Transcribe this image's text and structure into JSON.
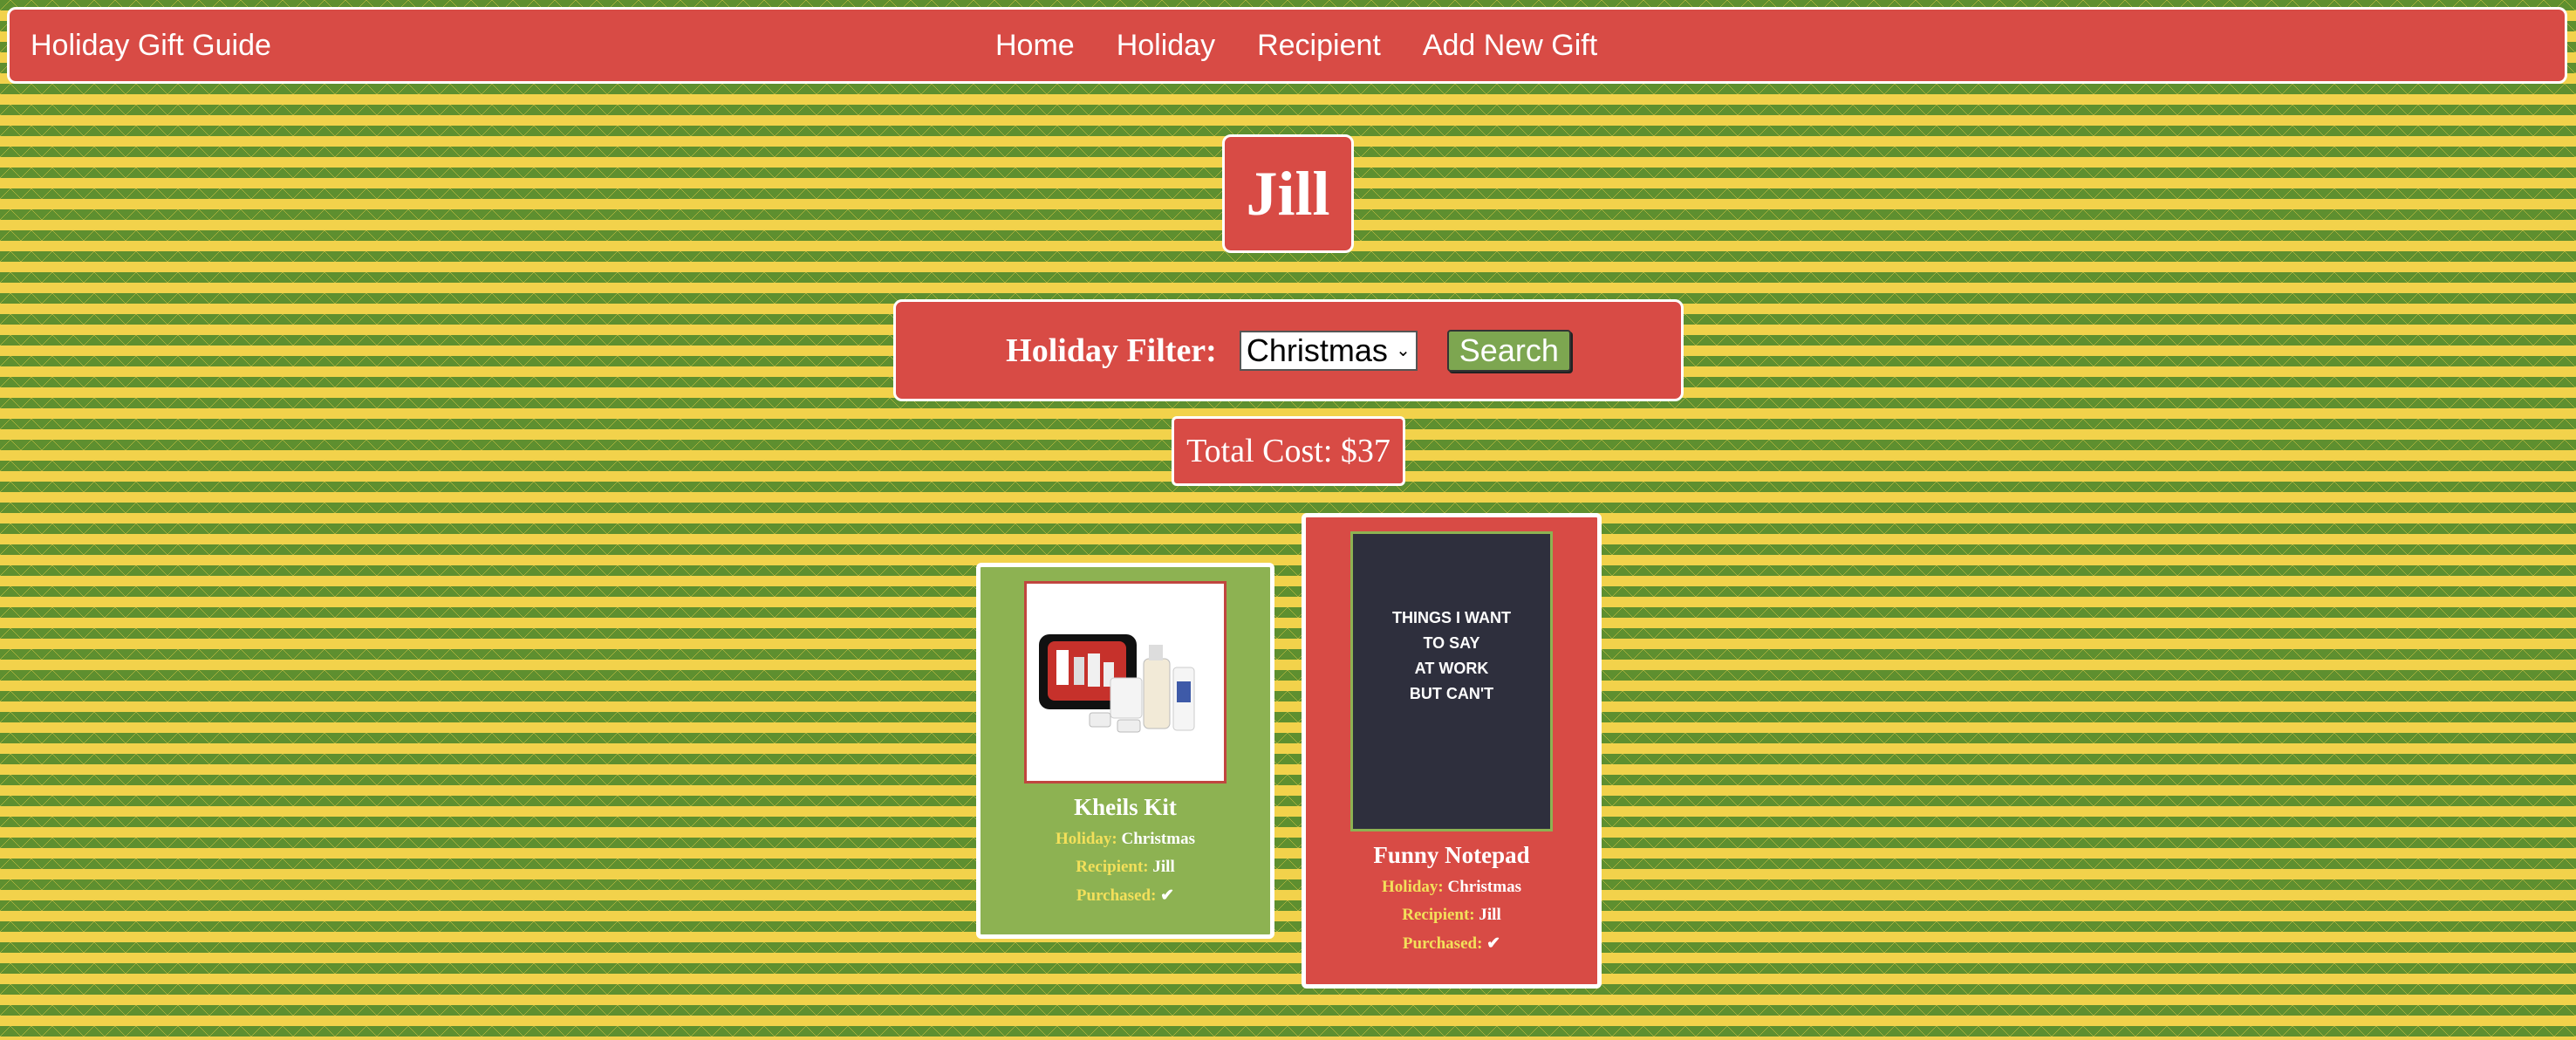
{
  "nav": {
    "brand": "Holiday Gift Guide",
    "links": [
      "Home",
      "Holiday",
      "Recipient",
      "Add New Gift"
    ]
  },
  "recipient": {
    "name": "Jill"
  },
  "filter": {
    "label": "Holiday Filter:",
    "selected": "Christmas",
    "button": "Search"
  },
  "total": {
    "text": "Total Cost: $37"
  },
  "gifts": [
    {
      "title": "Kheils Kit",
      "holiday_label": "Holiday:",
      "holiday": "Christmas",
      "recipient_label": "Recipient:",
      "recipient": "Jill",
      "purchased_label": "Purchased:",
      "purchased": "✔",
      "card_color": "#8db252"
    },
    {
      "title": "Funny Notepad",
      "holiday_label": "Holiday:",
      "holiday": "Christmas",
      "recipient_label": "Recipient:",
      "recipient": "Jill",
      "purchased_label": "Purchased:",
      "purchased": "✔",
      "card_color": "#d84b45",
      "image_text": [
        "THINGS I WANT",
        "TO SAY",
        "AT WORK",
        "BUT CAN'T"
      ]
    }
  ],
  "colors": {
    "primary_red": "#d84b45",
    "green": "#8db252",
    "label_yellow": "#f3e05a"
  }
}
